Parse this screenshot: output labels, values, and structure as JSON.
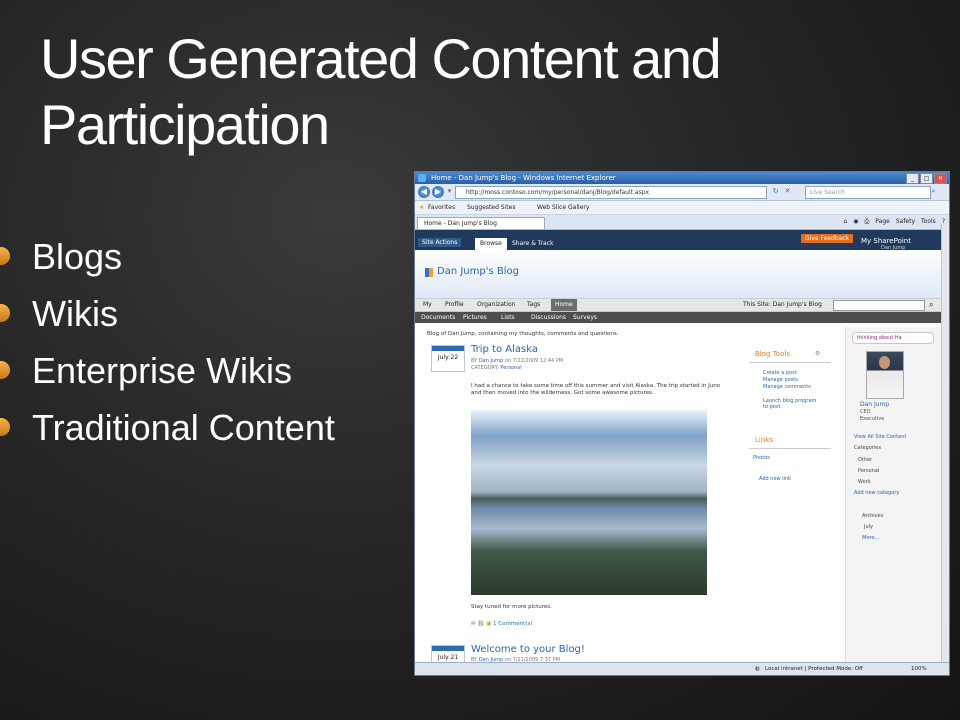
{
  "slide": {
    "title": "User Generated Content and Participation",
    "bullets": [
      "Blogs",
      "Wikis",
      "Enterprise Wikis",
      "Traditional Content"
    ]
  },
  "browser": {
    "window_title": "Home - Dan Jump's Blog - Windows Internet Explorer",
    "url": "http://moss.contoso.com/my/personal/danj/Blog/default.aspx",
    "search_placeholder": "Live Search",
    "favorites": [
      "Favorites",
      "Suggested Sites",
      "Web Slice Gallery"
    ],
    "tab_label": "Home - Dan Jump's Blog",
    "command_items": [
      "Page",
      "Safety",
      "Tools"
    ],
    "status": {
      "zone": "Local intranet | Protected Mode: Off",
      "zoom": "100%"
    }
  },
  "sharepoint": {
    "site_actions": "Site Actions",
    "ribbon_tabs": [
      "Browse",
      "Share & Track"
    ],
    "give_feedback": "Give Feedback",
    "my_sharepoint": "My SharePoint",
    "user_short": "Dan Jump",
    "blog_title": "Dan Jump's Blog",
    "top_nav": [
      "My",
      "Profile",
      "Organization",
      "Tags",
      "Home"
    ],
    "search_label": "This Site: Dan Jump's Blog",
    "quick_launch": [
      "Documents",
      "Pictures",
      "Lists",
      "Discussions",
      "Surveys"
    ],
    "blog_description": "Blog of Dan Jump, containing my thoughts, comments and questions.",
    "posts": [
      {
        "date": "July 22",
        "title": "Trip to Alaska",
        "by_label": "BY",
        "author": "Dan Jump",
        "timestamp": "on 7/22/2009 12:44 PM",
        "category_label": "CATEGORY:",
        "category": "Personal",
        "body": "I had a chance to take some time off this summer and visit Alaska.  The trip started in Juno and then moved into the wilderness.  Got some awesome pictures.",
        "footer": "Stay tuned for more pictures.",
        "comments": "1 Comment(s)"
      },
      {
        "date": "July 21",
        "title": "Welcome to your Blog!",
        "by_label": "BY",
        "author": "Dan Jump",
        "timestamp": "on 7/21/2009 7:37 PM"
      }
    ],
    "blog_tools": {
      "title": "Blog Tools",
      "items": [
        "Create a post",
        "Manage posts",
        "Manage comments",
        "Launch blog program to post"
      ]
    },
    "links": {
      "title": "Links",
      "items": [
        "Photos"
      ],
      "add": "Add new link"
    },
    "profile": {
      "status": "thinking about Ha",
      "name": "Dan Jump",
      "title1": "CEO",
      "title2": "Executive",
      "view_all": "View All Site Content",
      "categories_label": "Categories",
      "categories": [
        "Other",
        "Personal",
        "Work"
      ],
      "add_category": "Add new category",
      "archives_label": "Archives",
      "archive_month": "July",
      "more": "More..."
    }
  },
  "colors": {
    "accent_orange": "#e56b1f",
    "link_blue": "#2a64b0",
    "ribbon_navy": "#1f3a5c",
    "bullet_orange": "#f2a13a"
  }
}
